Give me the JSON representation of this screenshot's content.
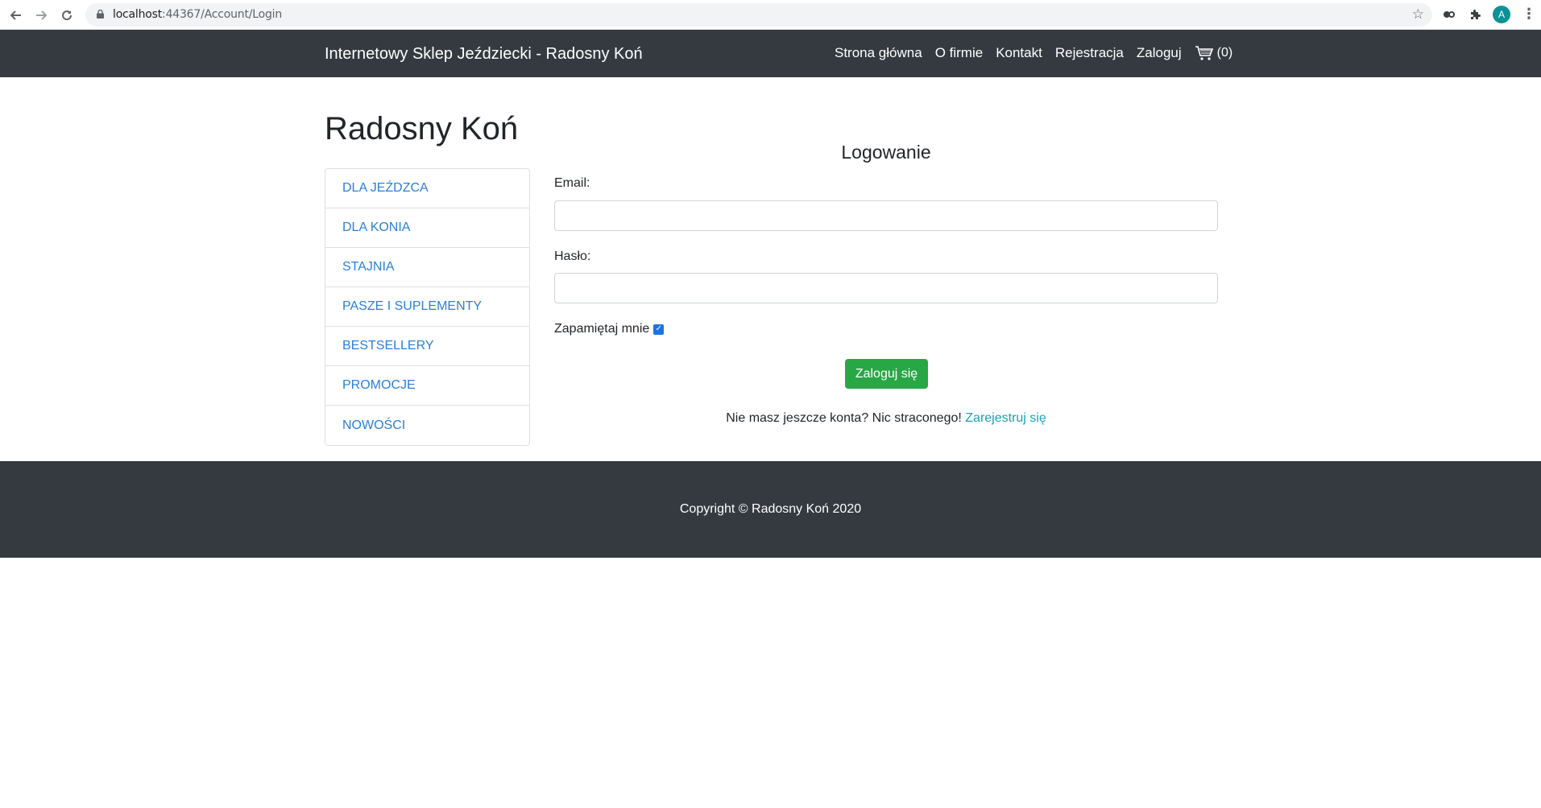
{
  "browser": {
    "url_host": "localhost",
    "url_path": ":44367/Account/Login",
    "avatar_letter": "A"
  },
  "navbar": {
    "brand": "Internetowy Sklep Jeździecki - Radosny Koń",
    "links": [
      "Strona główna",
      "O firmie",
      "Kontakt",
      "Rejestracja",
      "Zaloguj"
    ],
    "cart_count": "(0)"
  },
  "main": {
    "site_title": "Radosny Koń",
    "sidebar": [
      "DLA JEŹDZCA",
      "DLA KONIA",
      "STAJNIA",
      "PASZE I SUPLEMENTY",
      "BESTSELLERY",
      "PROMOCJE",
      "NOWOŚCI"
    ]
  },
  "login": {
    "title": "Logowanie",
    "email_label": "Email:",
    "email_value": "",
    "password_label": "Hasło:",
    "password_value": "",
    "remember_label": "Zapamiętaj mnie",
    "remember_checked": true,
    "submit_label": "Zaloguj się",
    "register_prompt": "Nie masz jeszcze konta? Nic straconego! ",
    "register_link": "Zarejestruj się"
  },
  "footer": {
    "text": "Copyright © Radosny Koń 2020"
  },
  "colors": {
    "navbar_bg": "#343a40",
    "link": "#2b7fd6",
    "button": "#28a745",
    "register_link": "#17a2b8"
  }
}
